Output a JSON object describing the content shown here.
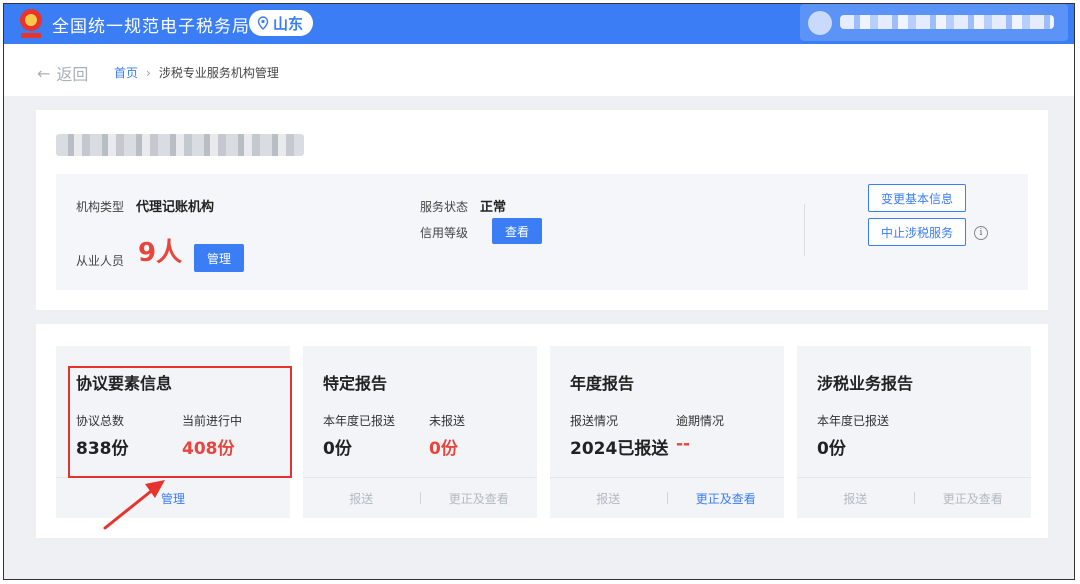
{
  "header": {
    "site_title": "全国统一规范电子税务局",
    "region": "山东",
    "colors": {
      "bar": "#3a7df5"
    },
    "icons": [
      "emblem-logo",
      "location-pin-icon",
      "user-avatar-icon"
    ]
  },
  "nav": {
    "back_label": "返回",
    "breadcrumb": {
      "home": "首页",
      "current": "涉税专业服务机构管理"
    }
  },
  "info": {
    "org_type_label": "机构类型",
    "org_type_value": "代理记账机构",
    "staff_label": "从业人员",
    "staff_count": "9人",
    "staff_manage_button": "管理",
    "service_status_label": "服务状态",
    "service_status_value": "正常",
    "credit_level_label": "信用等级",
    "credit_view_button": "查看",
    "change_info_button": "变更基本信息",
    "stop_service_button": "中止涉税服务"
  },
  "cards": {
    "agreement": {
      "title": "协议要素信息",
      "total_label": "协议总数",
      "total_value": "838份",
      "ongoing_label": "当前进行中",
      "ongoing_value": "408份",
      "manage_link": "管理"
    },
    "special": {
      "title": "特定报告",
      "sent_label": "本年度已报送",
      "sent_value": "0份",
      "unsent_label": "未报送",
      "unsent_value": "0份",
      "submit_link": "报送",
      "correct_link": "更正及查看"
    },
    "annual": {
      "title": "年度报告",
      "status_label": "报送情况",
      "status_value": "2024已报送",
      "overdue_label": "逾期情况",
      "overdue_value": "--",
      "submit_link": "报送",
      "correct_link": "更正及查看"
    },
    "tax_business": {
      "title": "涉税业务报告",
      "sent_label": "本年度已报送",
      "sent_value": "0份",
      "submit_link": "报送",
      "correct_link": "更正及查看"
    }
  }
}
